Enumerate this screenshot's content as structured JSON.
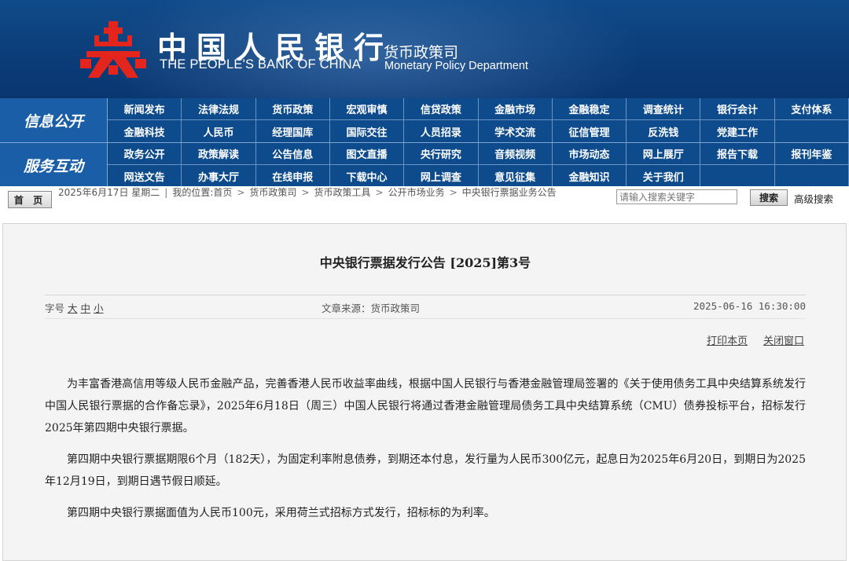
{
  "header": {
    "bank_name_cn": "中国人民银行",
    "bank_name_en": "THE PEOPLE'S BANK OF CHINA",
    "dept_cn": "货币政策司",
    "dept_en": "Monetary Policy Department",
    "emblem_color": "#e3251e"
  },
  "nav": {
    "section1": "信息公开",
    "section2": "服务互动",
    "row1": [
      "新闻发布",
      "法律法规",
      "货币政策",
      "宏观审慎",
      "信贷政策",
      "金融市场",
      "金融稳定",
      "调查统计",
      "银行会计",
      "支付体系"
    ],
    "row2": [
      "金融科技",
      "人民币",
      "经理国库",
      "国际交往",
      "人员招录",
      "学术交流",
      "征信管理",
      "反洗钱",
      "党建工作",
      ""
    ],
    "row3": [
      "政务公开",
      "政策解读",
      "公告信息",
      "图文直播",
      "央行研究",
      "音频视频",
      "市场动态",
      "网上展厅",
      "报告下载",
      "报刊年鉴"
    ],
    "row4": [
      "网送文告",
      "办事大厅",
      "在线申报",
      "下载中心",
      "网上调查",
      "意见征集",
      "金融知识",
      "关于我们",
      "",
      ""
    ]
  },
  "infobar": {
    "home": "首 页",
    "date": "2025年6月17日 星期二",
    "location_label": "我的位置:首页",
    "crumbs": [
      "货币政策司",
      "货币政策工具",
      "公开市场业务",
      "中央银行票据业务公告"
    ],
    "search_placeholder": "请输入搜索关键字",
    "search_button": "搜索",
    "advanced_search": "高级搜索"
  },
  "article": {
    "title": "中央银行票据发行公告 [2025]第3号",
    "font_size_label": "字号",
    "font_size_large": "大",
    "font_size_medium": "中",
    "font_size_small": "小",
    "source": "文章来源：货币政策司",
    "datetime": "2025-06-16 16:30:00",
    "print": "打印本页",
    "close": "关闭窗口",
    "paragraphs": [
      "为丰富香港高信用等级人民币金融产品，完善香港人民币收益率曲线，根据中国人民银行与香港金融管理局签署的《关于使用债务工具中央结算系统发行中国人民银行票据的合作备忘录》，2025年6月18日（周三）中国人民银行将通过香港金融管理局债务工具中央结算系统（CMU）债券投标平台，招标发行2025年第四期中央银行票据。",
      "第四期中央银行票据期限6个月（182天），为固定利率附息债券，到期还本付息，发行量为人民币300亿元，起息日为2025年6月20日，到期日为2025年12月19日，到期日遇节假日顺延。",
      "第四期中央银行票据面值为人民币100元，采用荷兰式招标方式发行，招标标的为利率。"
    ]
  }
}
